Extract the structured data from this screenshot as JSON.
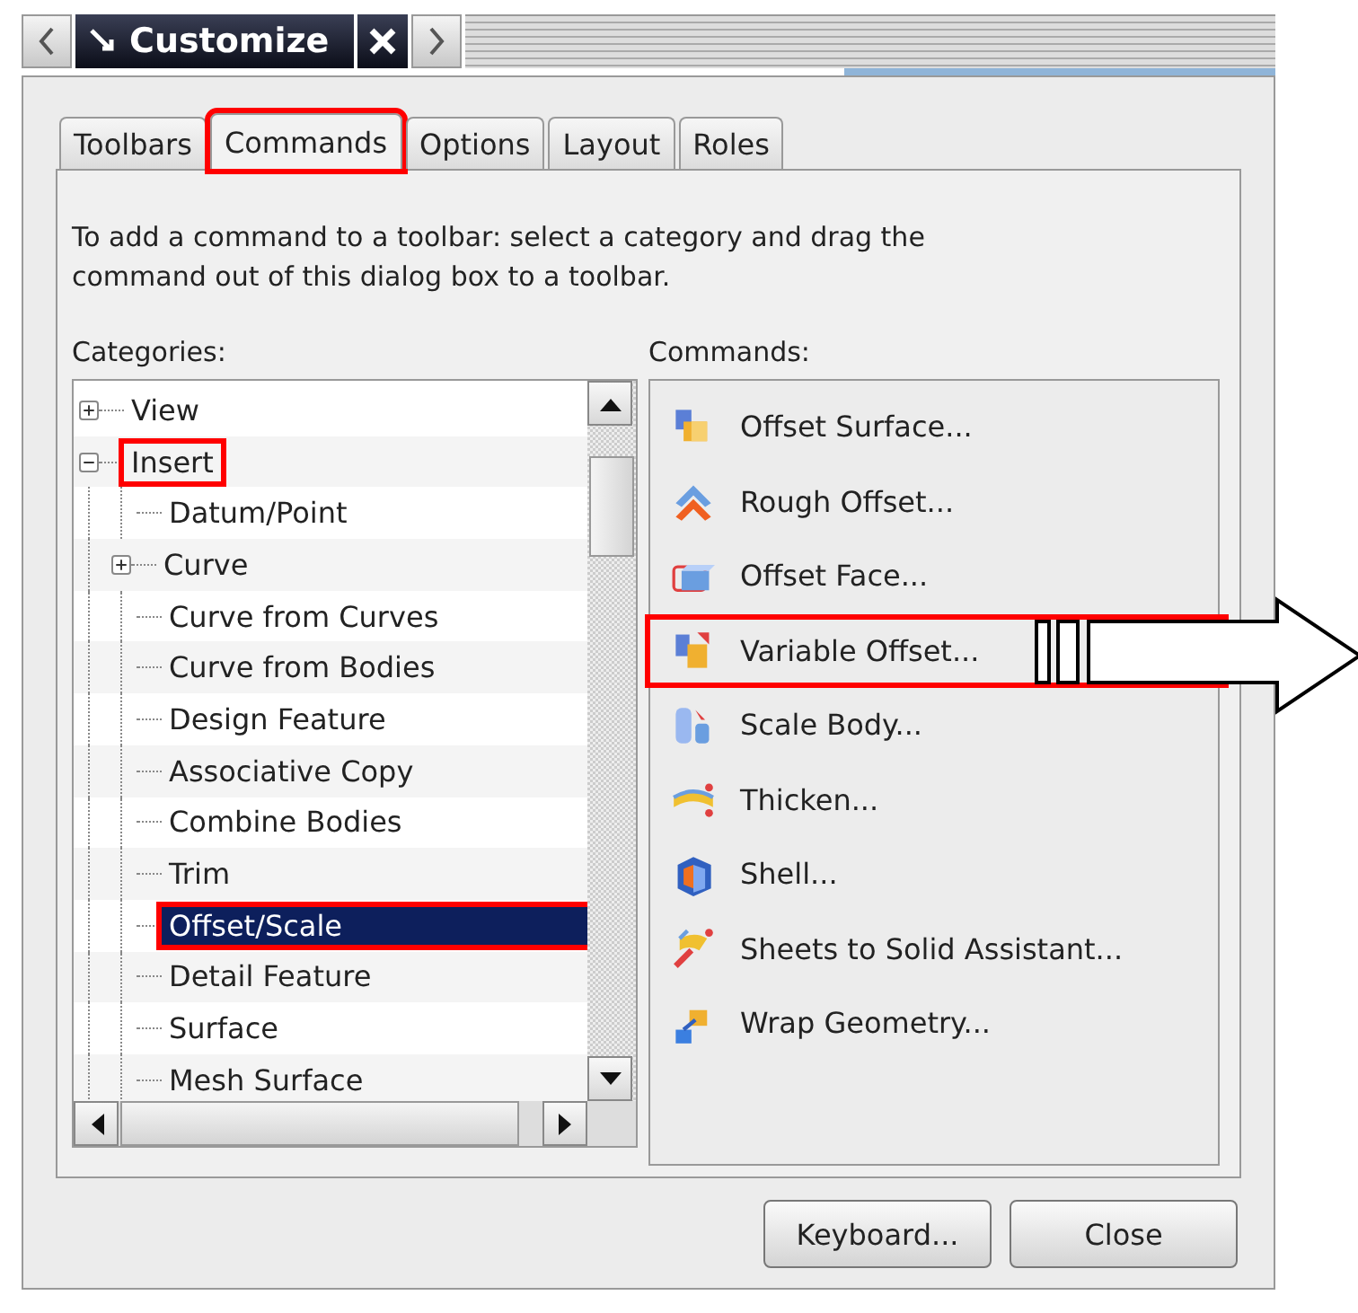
{
  "window": {
    "title": "Customize"
  },
  "tabs": [
    {
      "label": "Toolbars",
      "selected": false,
      "highlighted": false
    },
    {
      "label": "Commands",
      "selected": true,
      "highlighted": true
    },
    {
      "label": "Options",
      "selected": false,
      "highlighted": false
    },
    {
      "label": "Layout",
      "selected": false,
      "highlighted": false
    },
    {
      "label": "Roles",
      "selected": false,
      "highlighted": false
    }
  ],
  "instructions": "To add a command to a toolbar: select a category and drag the command out of this dialog box to a toolbar.",
  "categories": {
    "label": "Categories:",
    "items": [
      {
        "label": "View",
        "kind": "folder",
        "expanded": false,
        "selected": false,
        "highlighted": false
      },
      {
        "label": "Insert",
        "kind": "folder",
        "expanded": true,
        "selected": false,
        "highlighted": true,
        "children": [
          {
            "label": "Datum/Point",
            "kind": "leaf",
            "selected": false,
            "highlighted": false
          },
          {
            "label": "Curve",
            "kind": "folder",
            "expanded": false,
            "selected": false,
            "highlighted": false
          },
          {
            "label": "Curve from Curves",
            "kind": "leaf",
            "selected": false,
            "highlighted": false
          },
          {
            "label": "Curve from Bodies",
            "kind": "leaf",
            "selected": false,
            "highlighted": false
          },
          {
            "label": "Design Feature",
            "kind": "leaf",
            "selected": false,
            "highlighted": false
          },
          {
            "label": "Associative Copy",
            "kind": "leaf",
            "selected": false,
            "highlighted": false
          },
          {
            "label": "Combine Bodies",
            "kind": "leaf",
            "selected": false,
            "highlighted": false
          },
          {
            "label": "Trim",
            "kind": "leaf",
            "selected": false,
            "highlighted": false
          },
          {
            "label": "Offset/Scale",
            "kind": "leaf",
            "selected": true,
            "highlighted": true
          },
          {
            "label": "Detail Feature",
            "kind": "leaf",
            "selected": false,
            "highlighted": false
          },
          {
            "label": "Surface",
            "kind": "leaf",
            "selected": false,
            "highlighted": false
          },
          {
            "label": "Mesh Surface",
            "kind": "leaf",
            "selected": false,
            "highlighted": false
          }
        ]
      }
    ]
  },
  "commands": {
    "label": "Commands:",
    "items": [
      {
        "label": "Offset Surface...",
        "highlighted": false
      },
      {
        "label": "Rough Offset...",
        "highlighted": false
      },
      {
        "label": "Offset Face...",
        "highlighted": false
      },
      {
        "label": "Variable Offset...",
        "highlighted": true
      },
      {
        "label": "Scale Body...",
        "highlighted": false
      },
      {
        "label": "Thicken...",
        "highlighted": false
      },
      {
        "label": "Shell...",
        "highlighted": false
      },
      {
        "label": "Sheets to Solid Assistant...",
        "highlighted": false
      },
      {
        "label": "Wrap Geometry...",
        "highlighted": false
      }
    ]
  },
  "buttons": [
    "Keyboard...",
    "Close"
  ]
}
